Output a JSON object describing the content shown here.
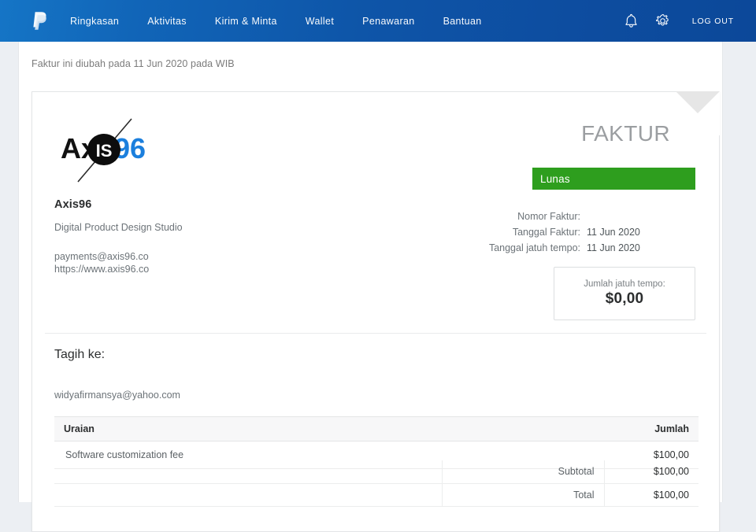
{
  "nav": {
    "logo_icon": "paypal-logo-icon",
    "links": [
      {
        "label": "Ringkasan"
      },
      {
        "label": "Aktivitas"
      },
      {
        "label": "Kirim & Minta"
      },
      {
        "label": "Wallet"
      },
      {
        "label": "Penawaran"
      },
      {
        "label": "Bantuan"
      }
    ],
    "bell_icon": "bell-icon",
    "gear_icon": "gear-icon",
    "logout_label": "LOG OUT"
  },
  "page": {
    "edited_note": "Faktur ini diubah pada 11 Jun 2020 pada WIB"
  },
  "invoice": {
    "title": "FAKTUR",
    "status": "Lunas",
    "status_color": "#2e9e1e",
    "logo": {
      "text_prefix": "Ax",
      "text_mid": "is",
      "text_suffix": "96",
      "badge_text": "IS",
      "accent_color": "#1b7fdd",
      "dark_color": "#111111"
    },
    "seller": {
      "name": "Axis96",
      "tagline": "Digital Product Design Studio",
      "email": "payments@axis96.co",
      "website": "https://www.axis96.co"
    },
    "meta": [
      {
        "label": "Nomor Faktur:",
        "value": ""
      },
      {
        "label": "Tanggal Faktur:",
        "value": "11 Jun 2020"
      },
      {
        "label": "Tanggal jatuh tempo:",
        "value": "11 Jun 2020"
      }
    ],
    "amount_due": {
      "label": "Jumlah jatuh tempo:",
      "value": "$0,00"
    },
    "bill_to": {
      "title": "Tagih ke:",
      "email": "widyafirmansya@yahoo.com"
    },
    "items_table": {
      "headers": {
        "description": "Uraian",
        "amount": "Jumlah"
      },
      "rows": [
        {
          "description": "Software customization fee",
          "amount": "$100,00"
        }
      ]
    },
    "totals": [
      {
        "label": "Subtotal",
        "value": "$100,00"
      },
      {
        "label": "Total",
        "value": "$100,00"
      }
    ]
  }
}
